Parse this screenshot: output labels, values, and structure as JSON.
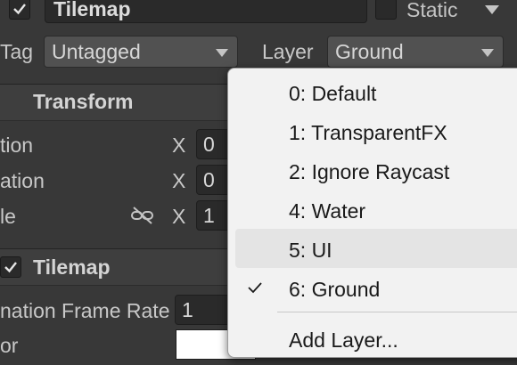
{
  "header": {
    "enabled_checked": true,
    "object_name": "Tilemap",
    "static_label": "Static"
  },
  "tag_row": {
    "tag_label": "Tag",
    "tag_value": "Untagged",
    "layer_label": "Layer",
    "layer_value": "Ground"
  },
  "transform": {
    "title": "Transform",
    "rows": [
      {
        "label": "tion",
        "axis": "X",
        "value": "0"
      },
      {
        "label": "ation",
        "axis": "X",
        "value": "0"
      },
      {
        "label": "le",
        "axis": "X",
        "value": "1"
      }
    ]
  },
  "tilemap": {
    "title": "Tilemap",
    "frame_rate_label": "nation Frame Rate",
    "frame_rate_value": "1",
    "color_label": "or"
  },
  "layer_menu": {
    "items": [
      {
        "label": "0: Default",
        "selected": false
      },
      {
        "label": "1: TransparentFX",
        "selected": false
      },
      {
        "label": "2: Ignore Raycast",
        "selected": false
      },
      {
        "label": "4: Water",
        "selected": false
      },
      {
        "label": "5: UI",
        "selected": false,
        "hovered": true
      },
      {
        "label": "6: Ground",
        "selected": true
      }
    ],
    "add_layer": "Add Layer..."
  },
  "icons": [
    "checkmark-icon",
    "dropdown-arrow-icon",
    "unlink-icon",
    "more-options-icon"
  ],
  "colors": {
    "panel_bg": "#383838",
    "field_bg": "#2a2a2a",
    "menu_bg": "#f2f2f2",
    "menu_hover": "#e4e4e4"
  }
}
